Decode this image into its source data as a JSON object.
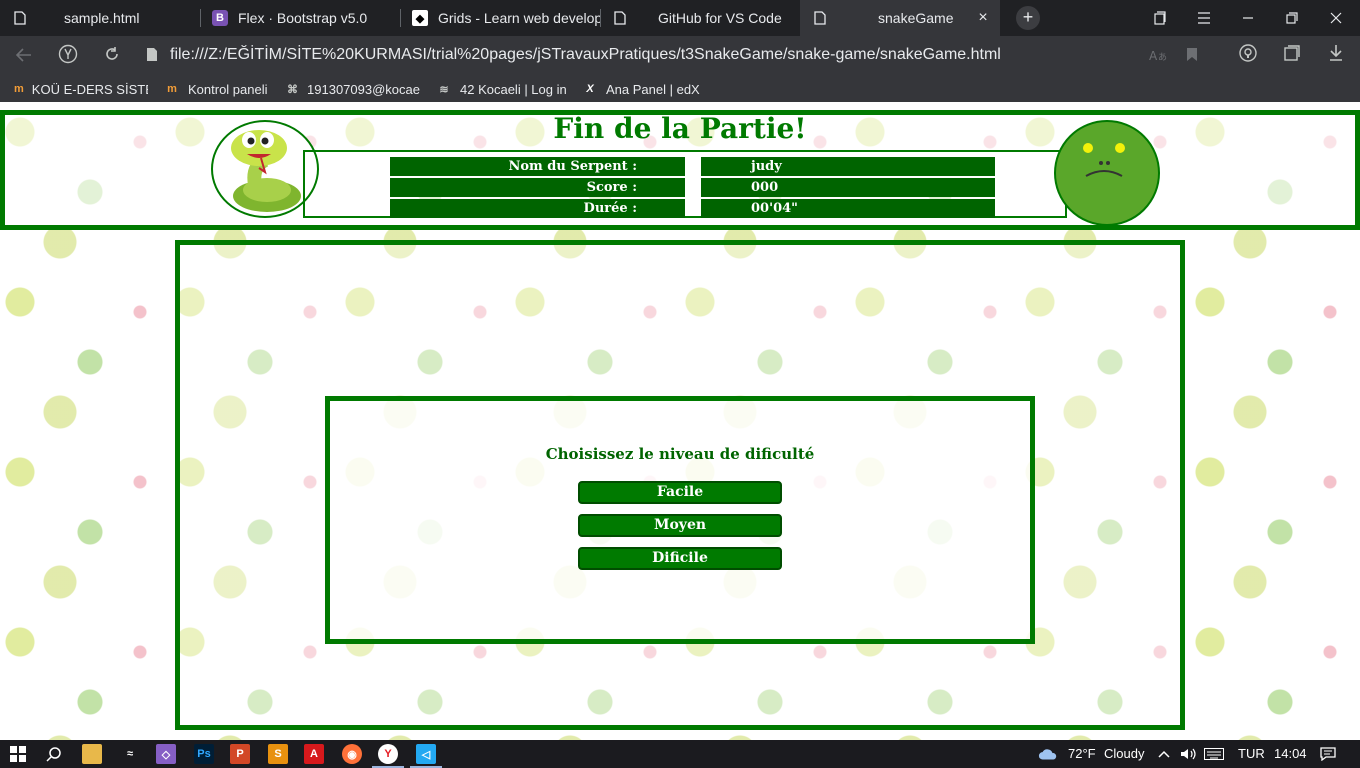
{
  "browser": {
    "tabs": [
      {
        "label": "sample.html",
        "icon": "document-icon",
        "active": false
      },
      {
        "label": "Flex · Bootstrap v5.0",
        "icon": "bootstrap-icon",
        "active": false
      },
      {
        "label": "Grids - Learn web develop",
        "icon": "mdn-icon",
        "active": false
      },
      {
        "label": "GitHub for VS Code",
        "icon": "document-icon",
        "active": false
      },
      {
        "label": "snakeGame",
        "icon": "document-icon",
        "active": true
      }
    ],
    "new_tab_label": "+",
    "close_tab_label": "×",
    "url": "file:///Z:/EĞİTİM/SİTE%20KURMASI/trial%20pages/jSTravauxPratiques/t3SnakeGame/snake-game/snakeGame.html",
    "bookmarks": [
      {
        "label": "KOÜ E-DERS SİSTEM",
        "icon": "moodle-icon"
      },
      {
        "label": "Kontrol paneli",
        "icon": "moodle-icon"
      },
      {
        "label": "191307093@kocae",
        "icon": "pattern-icon"
      },
      {
        "label": "42 Kocaeli | Log in",
        "icon": "42-icon"
      },
      {
        "label": "Ana Panel | edX",
        "icon": "edx-icon"
      }
    ]
  },
  "game": {
    "title": "Fin de la Partie!",
    "info": [
      {
        "label": "Nom du Serpent :",
        "value": "judy"
      },
      {
        "label": "Score :",
        "value": "000"
      },
      {
        "label": "Durée :",
        "value": "00'04\""
      }
    ],
    "level_prompt": "Choisissez le niveau de dificulté",
    "levels": [
      "Facile",
      "Moyen",
      "Dificile"
    ],
    "colors": {
      "primary": "#007a00",
      "dark": "#006400",
      "face": "#5aa72a"
    }
  },
  "taskbar": {
    "weather_temp": "72°F",
    "weather_desc": "Cloudy",
    "language": "TUR",
    "time": "14:04"
  }
}
